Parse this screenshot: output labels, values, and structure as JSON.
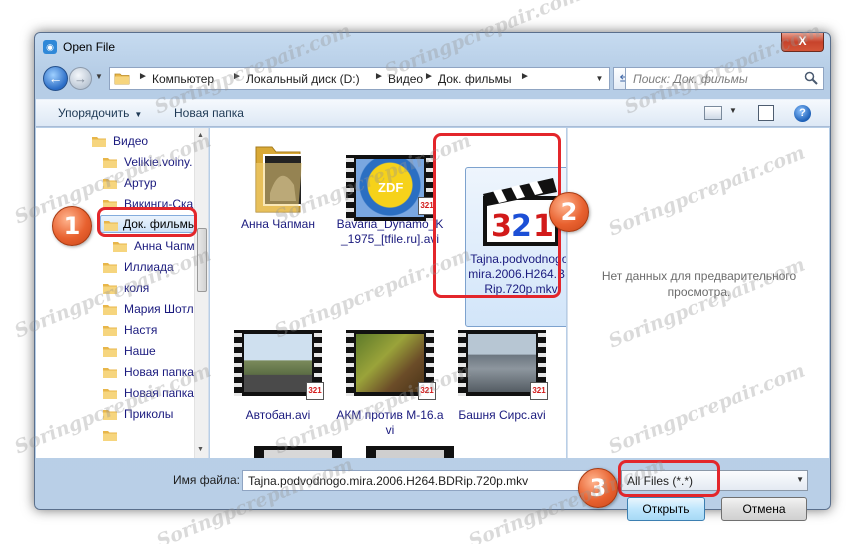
{
  "window": {
    "title": "Open File",
    "close_glyph": "X"
  },
  "navigation": {
    "back_glyph": "←",
    "forward_glyph": "→",
    "breadcrumb": [
      "Компьютер",
      "Локальный диск (D:)",
      "Видео",
      "Док. фильмы"
    ],
    "search_placeholder": "Поиск: Док. фильмы",
    "refresh_glyph": "⇆"
  },
  "toolbar": {
    "organize_label": "Упорядочить",
    "new_folder_label": "Новая папка",
    "help_glyph": "?"
  },
  "tree": [
    {
      "label": "Видео"
    },
    {
      "label": "Velikie.voiny."
    },
    {
      "label": "Артур"
    },
    {
      "label": "Викинги-Ска"
    },
    {
      "label": "Док. фильмы"
    },
    {
      "label": "Анна Чапм"
    },
    {
      "label": "Иллиада"
    },
    {
      "label": "коля"
    },
    {
      "label": "Мария Шотл"
    },
    {
      "label": "Настя"
    },
    {
      "label": "Наше"
    },
    {
      "label": "Новая папка"
    },
    {
      "label": "Новая папка"
    },
    {
      "label": "Приколы"
    }
  ],
  "files": [
    {
      "name": "Анна Чапман",
      "type": "folder"
    },
    {
      "name": "Bavaria_Dynamo_K_1975_[tfile.ru].avi",
      "type": "video"
    },
    {
      "name": "Tajna.podvodnogo.mira.2006.H264.BDRip.720p.mkv",
      "type": "mpc"
    },
    {
      "name": "Автобан.avi",
      "type": "video"
    },
    {
      "name": "АКМ против М-16.avi",
      "type": "video"
    },
    {
      "name": "Башня Сирс.avi",
      "type": "video"
    }
  ],
  "thumb_text": {
    "zdf": "ZDF",
    "mpc": "321",
    "badge": "321"
  },
  "preview": {
    "text": "Нет данных для предварительного просмотра."
  },
  "bottom": {
    "filename_label": "Имя файла:",
    "filename_value": "Tajna.podvodnogo.mira.2006.H264.BDRip.720p.mkv",
    "filter_value": "All Files (*.*)",
    "open_label": "Открыть",
    "cancel_label": "Отмена"
  },
  "annotations": {
    "step1": "1",
    "step2": "2",
    "step3": "3"
  },
  "watermark": "Soringpcrepair.com",
  "colors": {
    "highlight": "#e3262b",
    "step_badge": "#e8612f",
    "selection": "#cde2f8"
  }
}
